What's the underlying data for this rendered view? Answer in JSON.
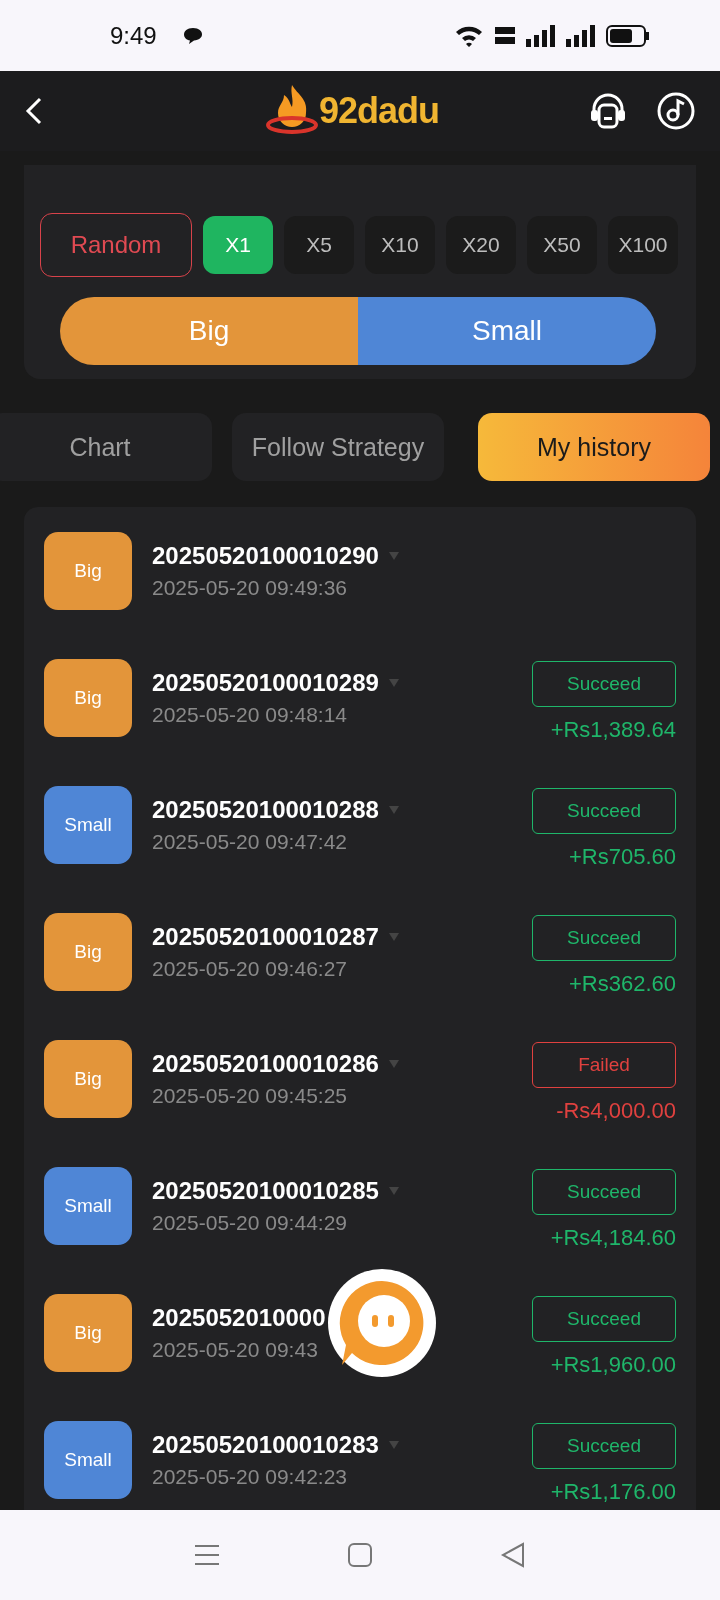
{
  "status_bar": {
    "time": "9:49"
  },
  "header": {
    "logo_text": "92dadu"
  },
  "multipliers": {
    "random_label": "Random",
    "options": [
      {
        "label": "X1",
        "selected": true
      },
      {
        "label": "X5",
        "selected": false
      },
      {
        "label": "X10",
        "selected": false
      },
      {
        "label": "X20",
        "selected": false
      },
      {
        "label": "X50",
        "selected": false
      },
      {
        "label": "X100",
        "selected": false
      }
    ]
  },
  "bet_buttons": [
    {
      "label": "Big",
      "kind": "big"
    },
    {
      "label": "Small",
      "kind": "small"
    }
  ],
  "tabs": [
    {
      "label": "Chart",
      "selected": false
    },
    {
      "label": "Follow Strategy",
      "selected": false
    },
    {
      "label": "My history",
      "selected": true
    }
  ],
  "history": [
    {
      "bet": "Big",
      "kind": "big",
      "period": "20250520100010290",
      "time": "2025-05-20 09:49:36"
    },
    {
      "bet": "Big",
      "kind": "big",
      "period": "20250520100010289",
      "time": "2025-05-20 09:48:14",
      "status": {
        "label": "Succeed",
        "kind": "win"
      },
      "amount": "+Rs1,389.64"
    },
    {
      "bet": "Small",
      "kind": "small",
      "period": "20250520100010288",
      "time": "2025-05-20 09:47:42",
      "status": {
        "label": "Succeed",
        "kind": "win"
      },
      "amount": "+Rs705.60"
    },
    {
      "bet": "Big",
      "kind": "big",
      "period": "20250520100010287",
      "time": "2025-05-20 09:46:27",
      "status": {
        "label": "Succeed",
        "kind": "win"
      },
      "amount": "+Rs362.60"
    },
    {
      "bet": "Big",
      "kind": "big",
      "period": "20250520100010286",
      "time": "2025-05-20 09:45:25",
      "status": {
        "label": "Failed",
        "kind": "loss"
      },
      "amount": "-Rs4,000.00"
    },
    {
      "bet": "Small",
      "kind": "small",
      "period": "20250520100010285",
      "time": "2025-05-20 09:44:29",
      "status": {
        "label": "Succeed",
        "kind": "win"
      },
      "amount": "+Rs4,184.60"
    },
    {
      "bet": "Big",
      "kind": "big",
      "period": "2025052010000",
      "time": "2025-05-20 09:43",
      "status": {
        "label": "Succeed",
        "kind": "win"
      },
      "amount": "+Rs1,960.00"
    },
    {
      "bet": "Small",
      "kind": "small",
      "period": "20250520100010283",
      "time": "2025-05-20 09:42:23",
      "status": {
        "label": "Succeed",
        "kind": "win"
      },
      "amount": "+Rs1,176.00"
    }
  ]
}
